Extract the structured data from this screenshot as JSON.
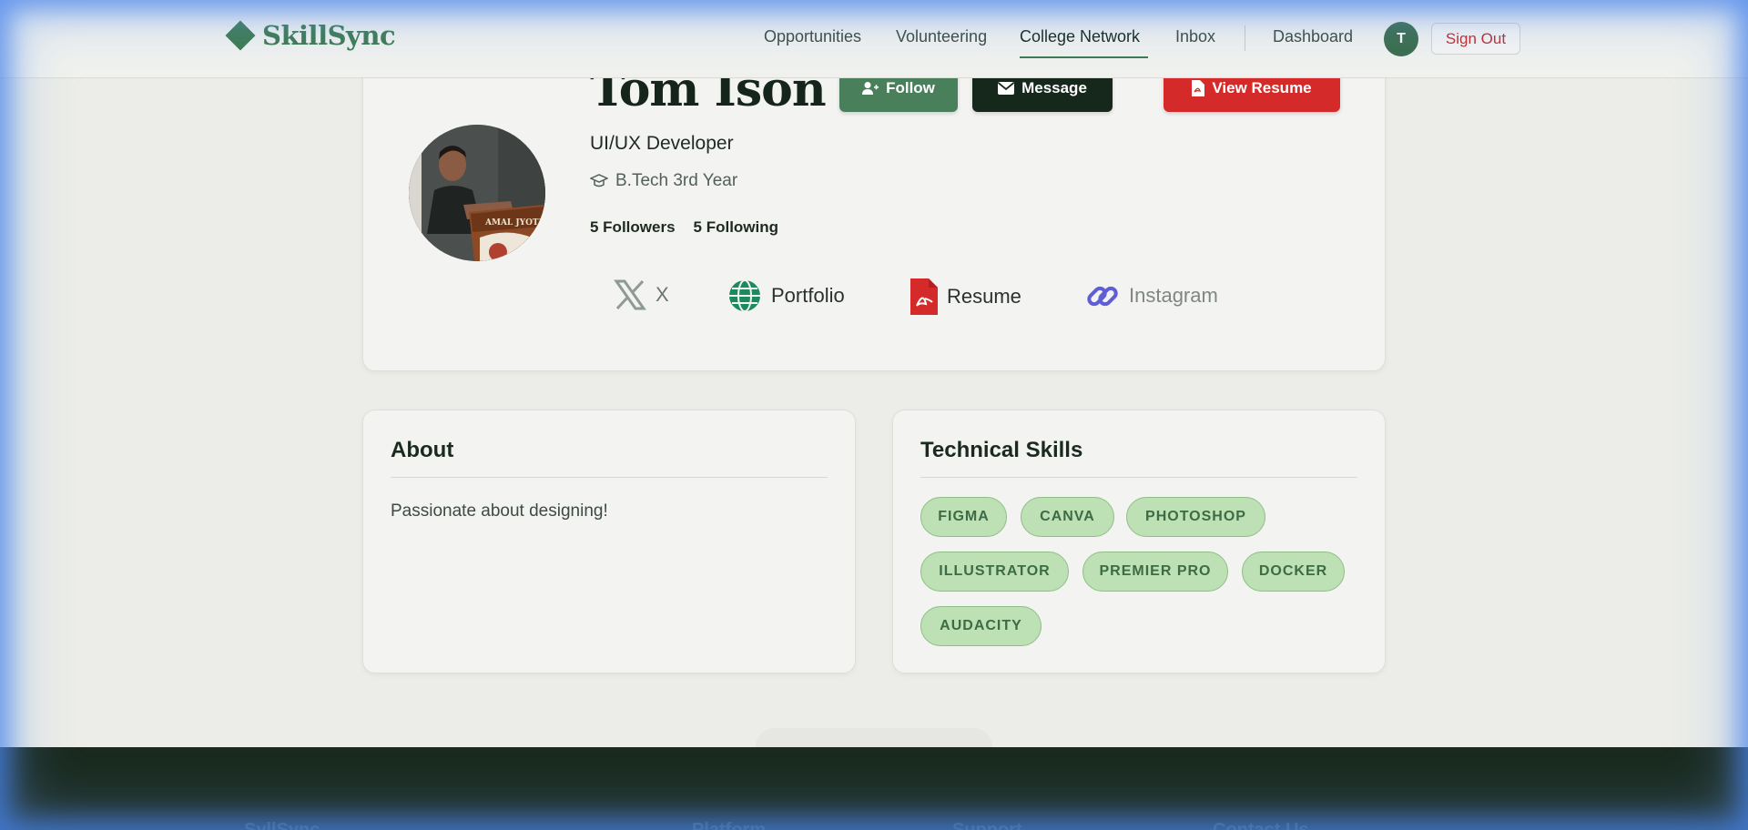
{
  "brand": {
    "name": "SkillSync"
  },
  "nav": {
    "items": [
      "Opportunities",
      "Volunteering",
      "College Network",
      "Inbox"
    ],
    "dashboard": "Dashboard",
    "avatar_initial": "T",
    "sign_out": "Sign Out"
  },
  "profile": {
    "name": "Tom Ison",
    "role": "UI/UX Developer",
    "education": "B.Tech 3rd Year",
    "followers": "5 Followers",
    "following": "5 Following",
    "buttons": {
      "follow": "Follow",
      "message": "Message",
      "resume": "View Resume"
    },
    "photo_sign": "AMAL JYOTHI",
    "links": [
      "X",
      "Portfolio",
      "Resume",
      "Instagram"
    ]
  },
  "about": {
    "title": "About",
    "text": "Passionate about designing!"
  },
  "skills": {
    "title": "Technical Skills",
    "items": [
      "FIGMA",
      "CANVA",
      "PHOTOSHOP",
      "ILLUSTRATOR",
      "PREMIER PRO",
      "DOCKER",
      "AUDACITY"
    ]
  },
  "footer": {
    "headings": [
      "SyllSync",
      "Platform",
      "Support",
      "Contact Us"
    ]
  },
  "colors": {
    "accent": "#3e7a52",
    "dark": "#16281c",
    "danger": "#d42a2a",
    "chip": "#bde0b4"
  }
}
